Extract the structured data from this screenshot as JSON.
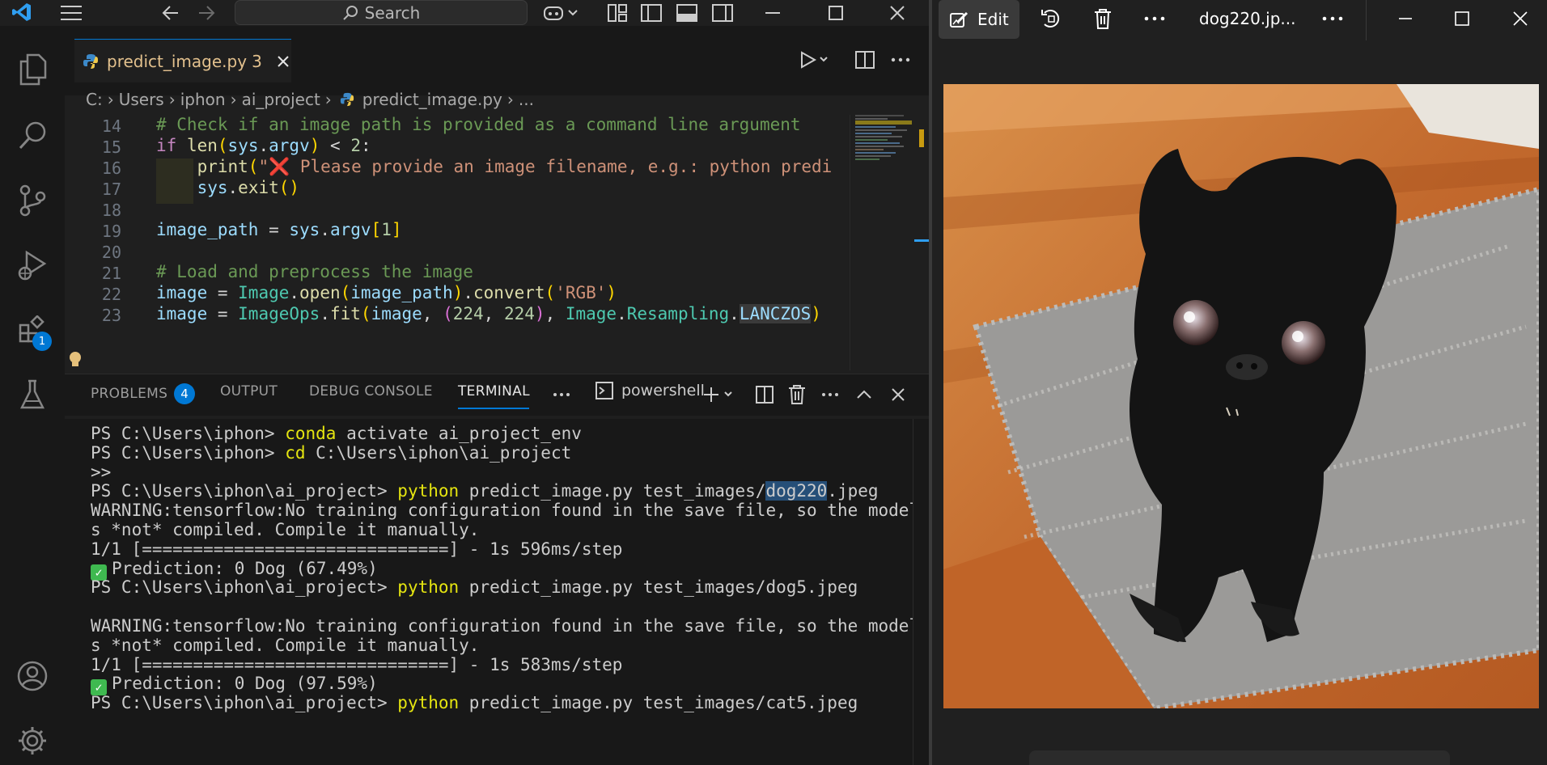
{
  "titlebar": {
    "search_placeholder": "Search"
  },
  "activity": {
    "extensions_badge": "1"
  },
  "editor": {
    "tab_label": "predict_image.py",
    "tab_problems": "3",
    "breadcrumb": [
      "C:",
      "Users",
      "iphon",
      "ai_project",
      "predict_image.py",
      "..."
    ],
    "code_lines": [
      {
        "num": "14",
        "text": "# Check if an image path is provided as a command line argument"
      },
      {
        "num": "15",
        "text": "if len(sys.argv) < 2:"
      },
      {
        "num": "16",
        "text": "    print(\"❌ Please provide an image filename, e.g.: python predi"
      },
      {
        "num": "17",
        "text": "    sys.exit()"
      },
      {
        "num": "18",
        "text": ""
      },
      {
        "num": "19",
        "text": "image_path = sys.argv[1]"
      },
      {
        "num": "20",
        "text": ""
      },
      {
        "num": "21",
        "text": "# Load and preprocess the image"
      },
      {
        "num": "22",
        "text": "image = Image.open(image_path).convert('RGB')"
      },
      {
        "num": "23",
        "text": "image = ImageOps.fit(image, (224, 224), Image.Resampling.LANCZOS)"
      }
    ]
  },
  "panel": {
    "tabs": [
      "PROBLEMS",
      "OUTPUT",
      "DEBUG CONSOLE",
      "TERMINAL"
    ],
    "problems_count": "4",
    "active_tab": "TERMINAL",
    "shell": "powershell",
    "terminal_lines": [
      "PS C:\\Users\\iphon> conda activate ai_project_env",
      "PS C:\\Users\\iphon> cd C:\\Users\\iphon\\ai_project",
      ">>",
      "PS C:\\Users\\iphon\\ai_project> python predict_image.py test_images/dog220.jpeg",
      "WARNING:tensorflow:No training configuration found in the save file, so the model wa",
      "s *not* compiled. Compile it manually.",
      "1/1 [==============================] - 1s 596ms/step",
      "✅ Prediction: 0 Dog (67.49%)",
      "PS C:\\Users\\iphon\\ai_project> python predict_image.py test_images/dog5.jpeg",
      "",
      "WARNING:tensorflow:No training configuration found in the save file, so the model wa",
      "s *not* compiled. Compile it manually.",
      "1/1 [==============================] - 1s 583ms/step",
      "✅ Prediction: 0 Dog (97.59%)",
      "PS C:\\Users\\iphon\\ai_project> python predict_image.py test_images/cat5.jpeg"
    ]
  },
  "photos": {
    "edit_label": "Edit",
    "file_title": "dog220.jp..."
  },
  "colors": {
    "accent": "#0078d4",
    "yellow_cmd": "#e5e510",
    "selection": "#264f78"
  }
}
